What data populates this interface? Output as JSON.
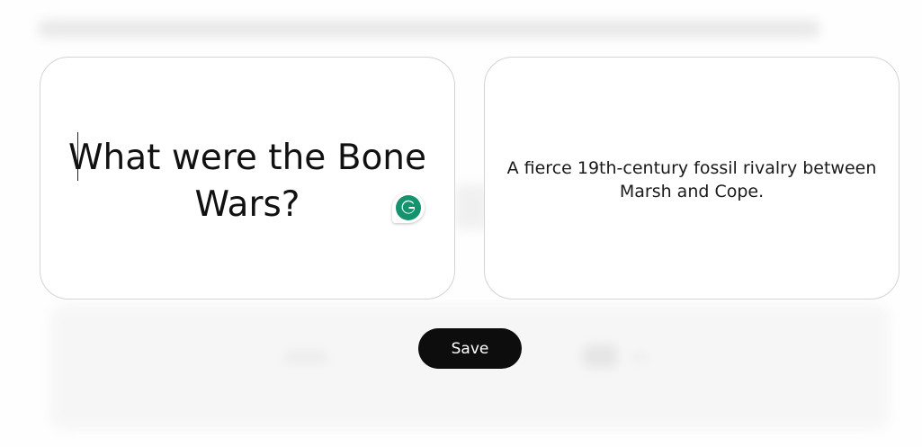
{
  "flashcard": {
    "front_text": "What were the Bone Wars?",
    "back_text": "A fierce 19th-century fossil rivalry between Marsh and Cope."
  },
  "actions": {
    "save_label": "Save"
  },
  "colors": {
    "button_bg": "#0d0d0d",
    "button_text": "#ffffff",
    "card_border": "#d4d4d4",
    "grammarly_green": "#15936e"
  },
  "icons": {
    "grammarly": "grammarly-icon"
  }
}
